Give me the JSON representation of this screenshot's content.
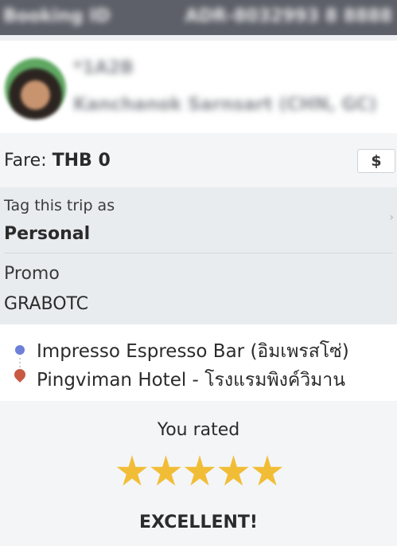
{
  "header": {
    "booking_label": "Booking ID",
    "booking_id": "ADR-8032993 8 8888"
  },
  "driver": {
    "plate": "*1A2B",
    "car_description": "Kanchanok Sarnsart (CHN, GC)"
  },
  "fare": {
    "label": "Fare: ",
    "value": "THB 0",
    "currency_button": "$"
  },
  "trip_tag": {
    "caption": "Tag this trip as",
    "value": "Personal",
    "chevron": "›"
  },
  "promo": {
    "caption": "Promo",
    "code": "GRABOTC"
  },
  "route": {
    "pickup": "Impresso Espresso Bar (อิมเพรสโซ่)",
    "dropoff": "Pingviman Hotel - โรงแรมพิงค์วิมาน",
    "pickup_color": "#6d7fd8",
    "dropoff_color": "#c85a44"
  },
  "rating": {
    "caption": "You rated",
    "stars": 5,
    "max_stars": 5,
    "word": "EXCELLENT!",
    "star_color": "#f2bd36"
  }
}
